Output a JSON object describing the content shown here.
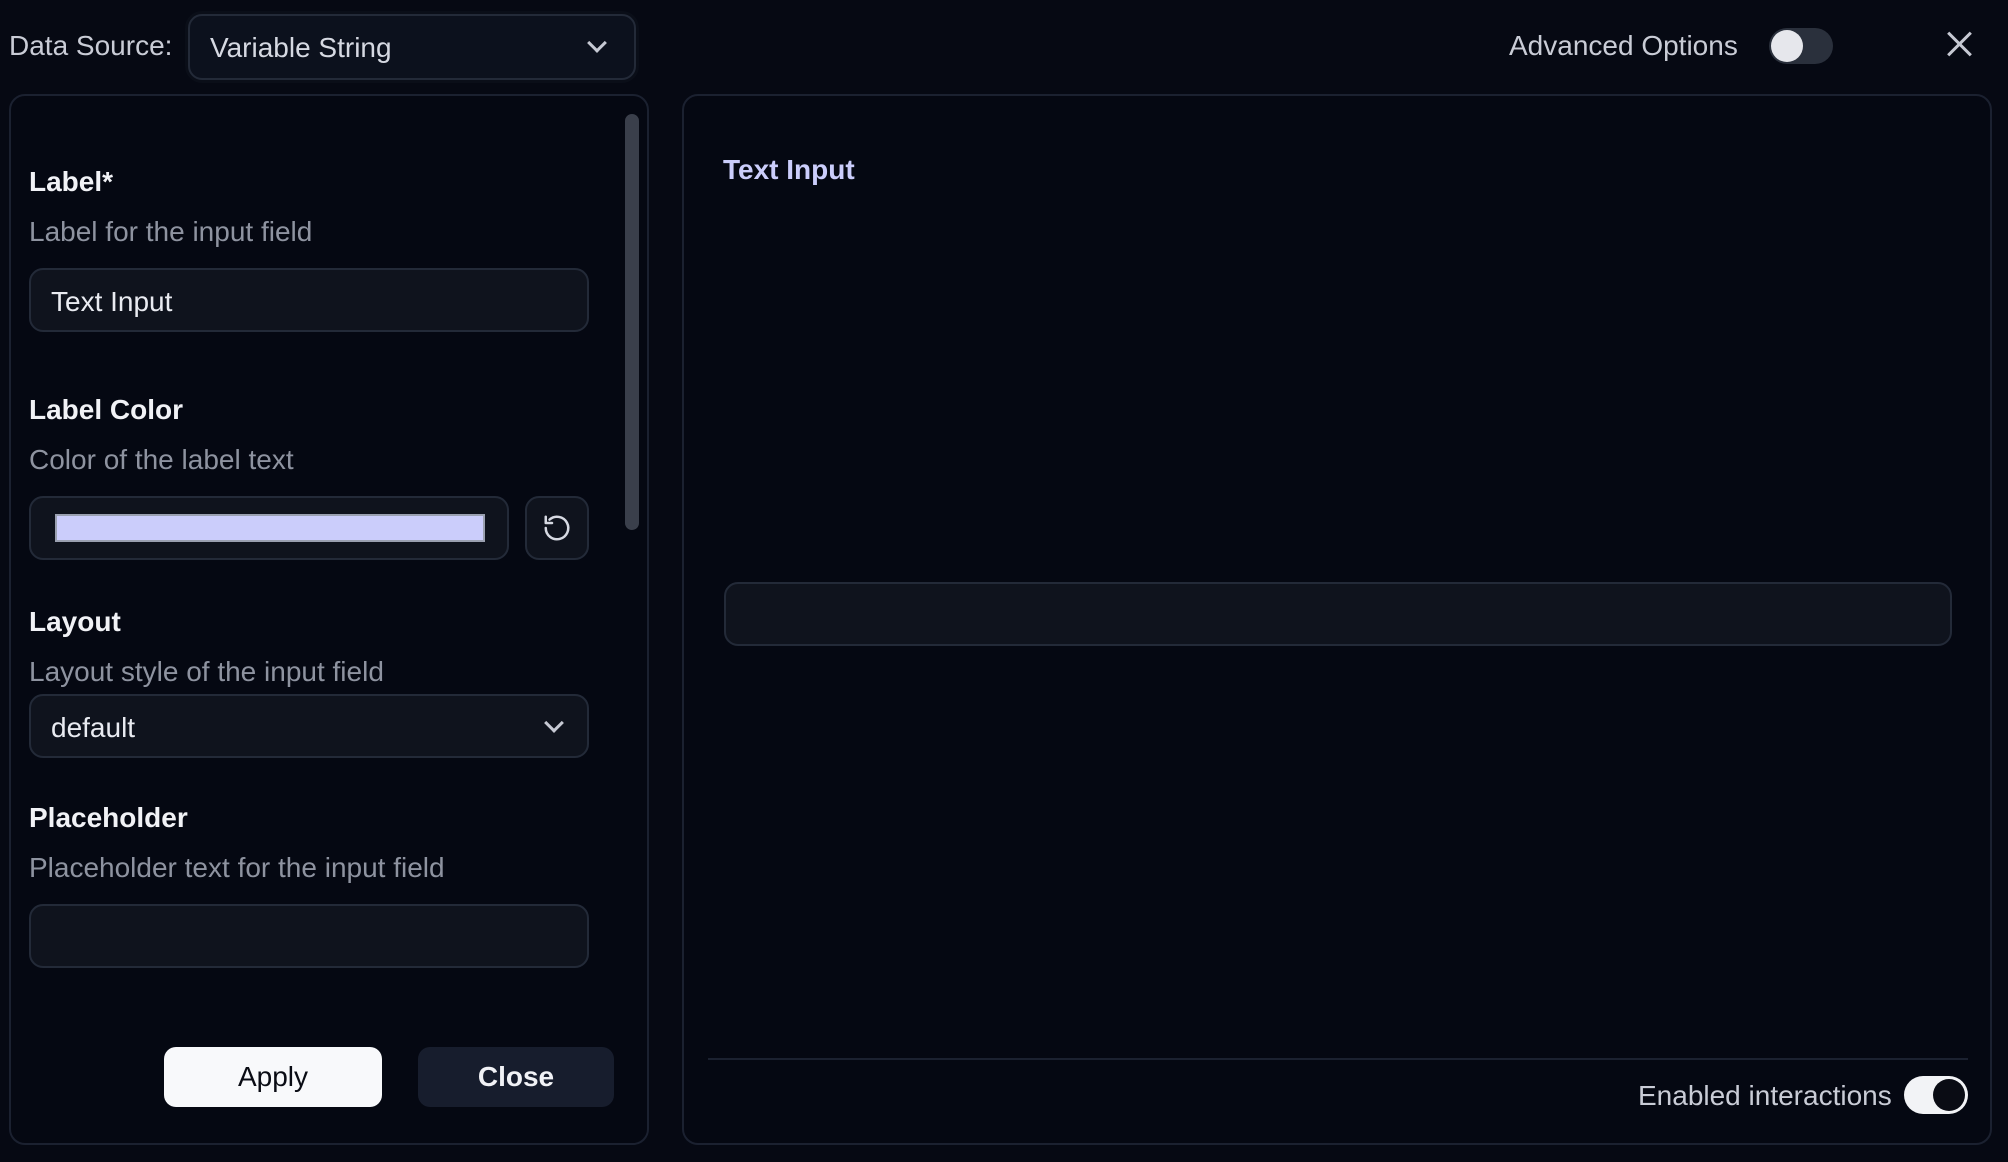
{
  "header": {
    "data_source_label": "Data Source:",
    "data_source_value": "Variable String",
    "advanced_options_label": "Advanced Options",
    "advanced_options_enabled": false
  },
  "fields": {
    "label": {
      "title": "Label*",
      "description": "Label for the input field",
      "value": "Text Input"
    },
    "label_color": {
      "title": "Label Color",
      "description": "Color of the label text",
      "value": "#cbcdfb"
    },
    "layout": {
      "title": "Layout",
      "description": "Layout style of the input field",
      "value": "default"
    },
    "placeholder": {
      "title": "Placeholder",
      "description": "Placeholder text for the input field",
      "value": ""
    }
  },
  "actions": {
    "apply_label": "Apply",
    "close_label": "Close"
  },
  "preview": {
    "label": "Text Input",
    "label_color": "#cbcdfb",
    "input_value": "",
    "enabled_interactions_label": "Enabled interactions",
    "enabled_interactions": true
  },
  "icons": {
    "dropdown": "chevron-down-icon",
    "reset": "reset-icon",
    "close": "close-icon"
  }
}
